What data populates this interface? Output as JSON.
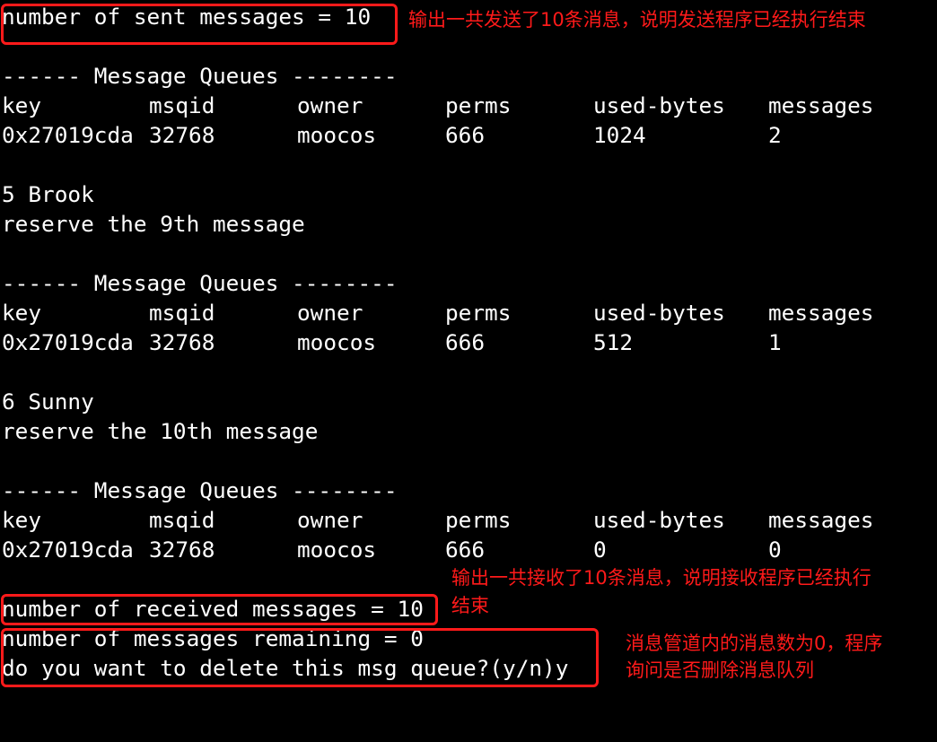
{
  "terminal": {
    "sent_line": "number of sent messages = 10",
    "blocks": [
      {
        "header": "------ Message Queues --------",
        "columns": [
          "key",
          "msqid",
          "owner",
          "perms",
          "used-bytes",
          "messages"
        ],
        "row": [
          "0x27019cda",
          "32768",
          "moocos",
          "666",
          "1024",
          "2"
        ]
      },
      {
        "header": "------ Message Queues --------",
        "columns": [
          "key",
          "msqid",
          "owner",
          "perms",
          "used-bytes",
          "messages"
        ],
        "row": [
          "0x27019cda",
          "32768",
          "moocos",
          "666",
          "512",
          "1"
        ]
      },
      {
        "header": "------ Message Queues --------",
        "columns": [
          "key",
          "msqid",
          "owner",
          "perms",
          "used-bytes",
          "messages"
        ],
        "row": [
          "0x27019cda",
          "32768",
          "moocos",
          "666",
          "0",
          "0"
        ]
      }
    ],
    "msg_5_name": "5 Brook",
    "msg_5_reserve": "reserve the 9th message",
    "msg_6_name": "6 Sunny",
    "msg_6_reserve": "reserve the 10th message",
    "received_line": "number of received messages = 10",
    "remaining_line": "number of messages remaining = 0",
    "delete_prompt": "do you want to delete this msg queue?(y/n)y"
  },
  "annotations": {
    "note_sent": "输出一共发送了10条消息，说明发送程序已经执行结束",
    "note_received_1": "输出一共接收了10条消息，说明接收程序已经执行",
    "note_received_2": "结束",
    "note_remaining_1": "消息管道内的消息数为0，程序",
    "note_remaining_2": "询问是否删除消息队列",
    "accent_color": "#ff1a1a"
  }
}
